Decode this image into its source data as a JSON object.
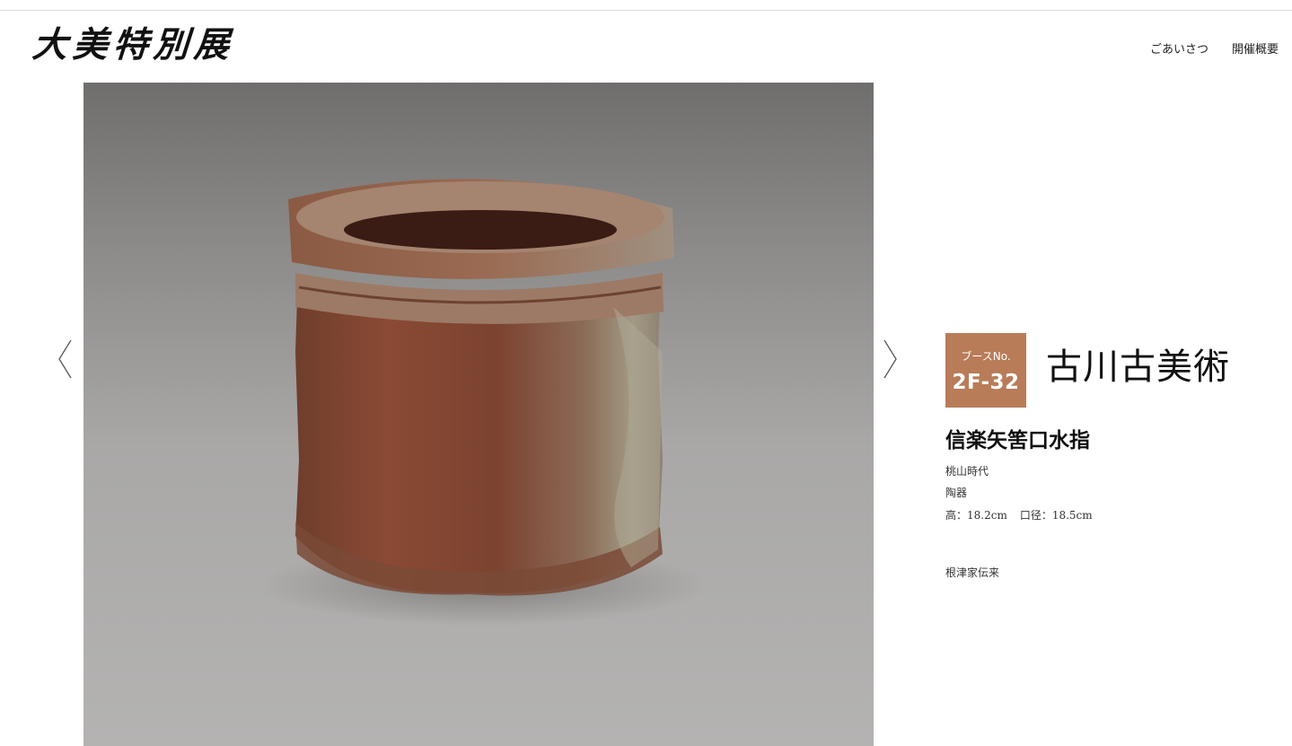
{
  "header": {
    "logo_text": "大美特別展",
    "nav": [
      {
        "label": "ごあいさつ"
      },
      {
        "label": "開催概要"
      }
    ]
  },
  "gallery": {
    "prev_icon": "chevron-left-icon",
    "next_icon": "chevron-right-icon"
  },
  "booth": {
    "label": "ブースNo.",
    "number": "2F-32",
    "badge_color": "#b87c58"
  },
  "dealer": {
    "name": "古川古美術"
  },
  "item": {
    "title": "信楽矢筈口水指",
    "period": "桃山時代",
    "material": "陶器",
    "height": "高：18.2cm",
    "diameter": "口径：18.5cm",
    "provenance": "根津家伝来"
  }
}
